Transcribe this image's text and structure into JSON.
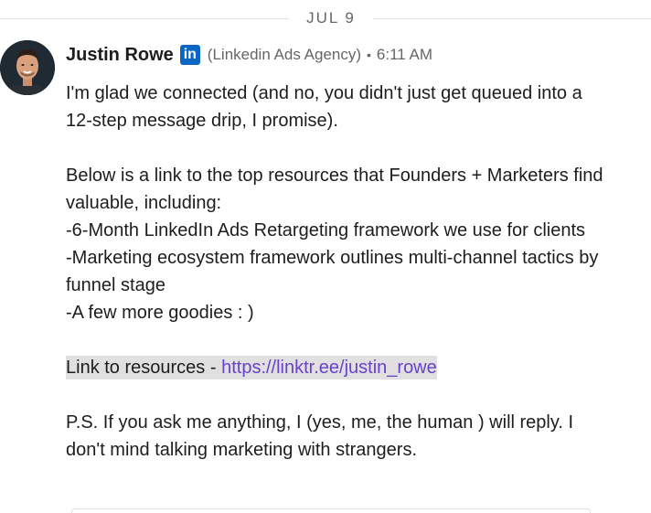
{
  "date_divider": {
    "label": "JUL 9"
  },
  "message": {
    "sender_name": "Justin Rowe",
    "sender_headline": "(Linkedin Ads Agency)",
    "separator": "•",
    "timestamp": "6:11 AM",
    "badge_icon": "linkedin-icon",
    "paragraph_1": "I'm glad we connected (and no, you didn't just get queued into a 12-step message drip, I promise).",
    "paragraph_2_intro": "Below is a link to the top resources that Founders + Marketers find valuable, including:",
    "bullets": [
      "-6-Month LinkedIn Ads Retargeting framework we use for clients",
      "-Marketing ecosystem framework outlines multi-channel tactics by funnel stage",
      "-A few more goodies : )"
    ],
    "link_prefix": "Link to resources - ",
    "link_text": "https://linktr.ee/justin_rowe",
    "paragraph_ps": "P.S. If you ask me anything, I (yes, me, the human ) will reply. I don't mind talking marketing with strangers."
  },
  "colors": {
    "linkedin_blue": "#0a66c2",
    "link_purple": "#6a41c9",
    "highlight_gray": "#e0e0e0",
    "meta_gray": "#666666"
  }
}
